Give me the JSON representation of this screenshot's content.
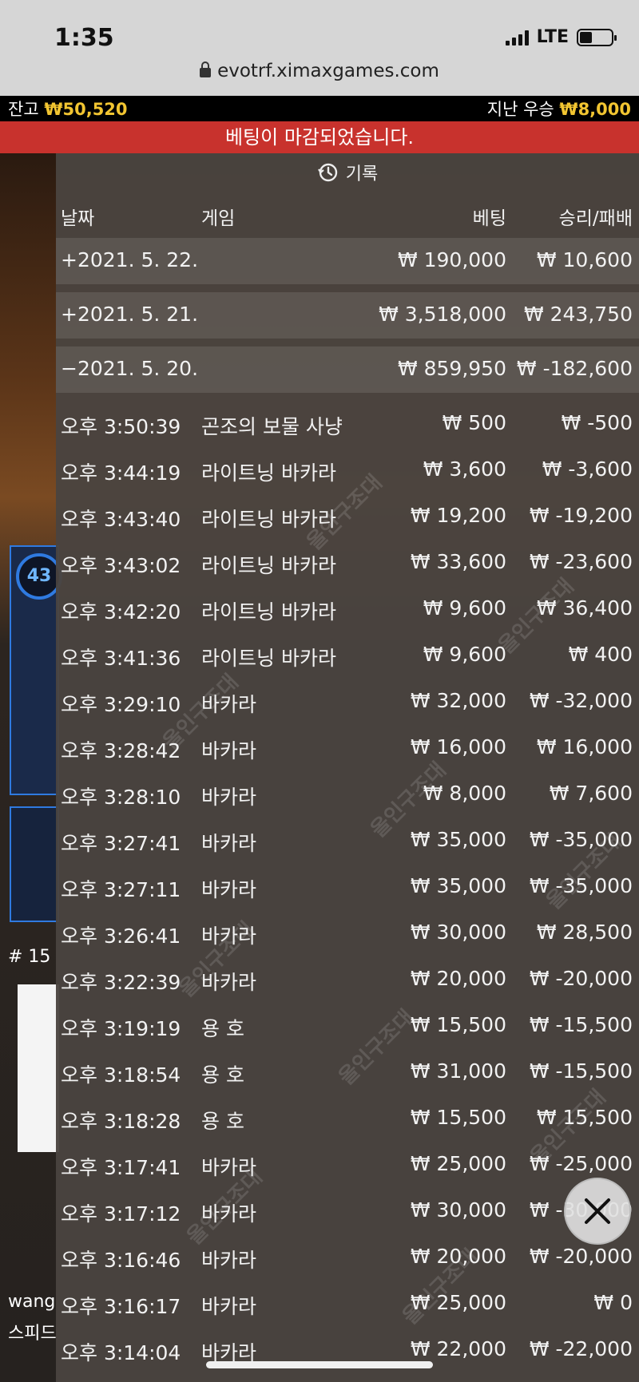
{
  "status_bar": {
    "time": "1:35",
    "network": "LTE"
  },
  "browser": {
    "url": "evotrf.ximaxgames.com"
  },
  "balance_bar": {
    "balance_label": "잔고",
    "balance_value": "₩50,520",
    "last_win_label": "지난 우승",
    "last_win_value": "₩8,000"
  },
  "banner": {
    "text": "베팅이 마감되었습니다."
  },
  "panel": {
    "title": "기록",
    "columns": {
      "date": "날짜",
      "game": "게임",
      "bet": "베팅",
      "result": "승리/패배"
    }
  },
  "day_rows": [
    {
      "date": "+2021. 5. 22.",
      "bet": "₩ 190,000",
      "result": "₩ 10,600"
    },
    {
      "date": "+2021. 5. 21.",
      "bet": "₩ 3,518,000",
      "result": "₩ 243,750"
    },
    {
      "date": "−2021. 5. 20.",
      "bet": "₩ 859,950",
      "result": "₩ -182,600"
    }
  ],
  "rows": [
    {
      "time": "오후 3:50:39",
      "game": "곤조의 보물 사냥",
      "bet": "₩ 500",
      "result": "₩ -500"
    },
    {
      "time": "오후 3:44:19",
      "game": "라이트닝 바카라",
      "bet": "₩ 3,600",
      "result": "₩ -3,600"
    },
    {
      "time": "오후 3:43:40",
      "game": "라이트닝 바카라",
      "bet": "₩ 19,200",
      "result": "₩ -19,200"
    },
    {
      "time": "오후 3:43:02",
      "game": "라이트닝 바카라",
      "bet": "₩ 33,600",
      "result": "₩ -23,600"
    },
    {
      "time": "오후 3:42:20",
      "game": "라이트닝 바카라",
      "bet": "₩ 9,600",
      "result": "₩ 36,400"
    },
    {
      "time": "오후 3:41:36",
      "game": "라이트닝 바카라",
      "bet": "₩ 9,600",
      "result": "₩ 400"
    },
    {
      "time": "오후 3:29:10",
      "game": "바카라",
      "bet": "₩ 32,000",
      "result": "₩ -32,000"
    },
    {
      "time": "오후 3:28:42",
      "game": "바카라",
      "bet": "₩ 16,000",
      "result": "₩ 16,000"
    },
    {
      "time": "오후 3:28:10",
      "game": "바카라",
      "bet": "₩ 8,000",
      "result": "₩ 7,600"
    },
    {
      "time": "오후 3:27:41",
      "game": "바카라",
      "bet": "₩ 35,000",
      "result": "₩ -35,000"
    },
    {
      "time": "오후 3:27:11",
      "game": "바카라",
      "bet": "₩ 35,000",
      "result": "₩ -35,000"
    },
    {
      "time": "오후 3:26:41",
      "game": "바카라",
      "bet": "₩ 30,000",
      "result": "₩ 28,500"
    },
    {
      "time": "오후 3:22:39",
      "game": "바카라",
      "bet": "₩ 20,000",
      "result": "₩ -20,000"
    },
    {
      "time": "오후 3:19:19",
      "game": "용 호",
      "bet": "₩ 15,500",
      "result": "₩ -15,500"
    },
    {
      "time": "오후 3:18:54",
      "game": "용 호",
      "bet": "₩ 31,000",
      "result": "₩ -15,500"
    },
    {
      "time": "오후 3:18:28",
      "game": "용 호",
      "bet": "₩ 15,500",
      "result": "₩ 15,500"
    },
    {
      "time": "오후 3:17:41",
      "game": "바카라",
      "bet": "₩ 25,000",
      "result": "₩ -25,000"
    },
    {
      "time": "오후 3:17:12",
      "game": "바카라",
      "bet": "₩ 30,000",
      "result": "₩ -30,000"
    },
    {
      "time": "오후 3:16:46",
      "game": "바카라",
      "bet": "₩ 20,000",
      "result": "₩ -20,000"
    },
    {
      "time": "오후 3:16:17",
      "game": "바카라",
      "bet": "₩ 25,000",
      "result": "₩ 0"
    },
    {
      "time": "오후 3:14:04",
      "game": "바카라",
      "bet": "₩ 22,000",
      "result": "₩ -22,000"
    }
  ],
  "background": {
    "circle_value": "43",
    "side_text_1": "wang",
    "side_text_2": "스피드",
    "hash_label": "# 15"
  },
  "watermark_text": "올인구조대",
  "colors": {
    "gold": "#f2c531",
    "banner_red": "#c8322d",
    "accent_blue": "#2f7ae0"
  }
}
